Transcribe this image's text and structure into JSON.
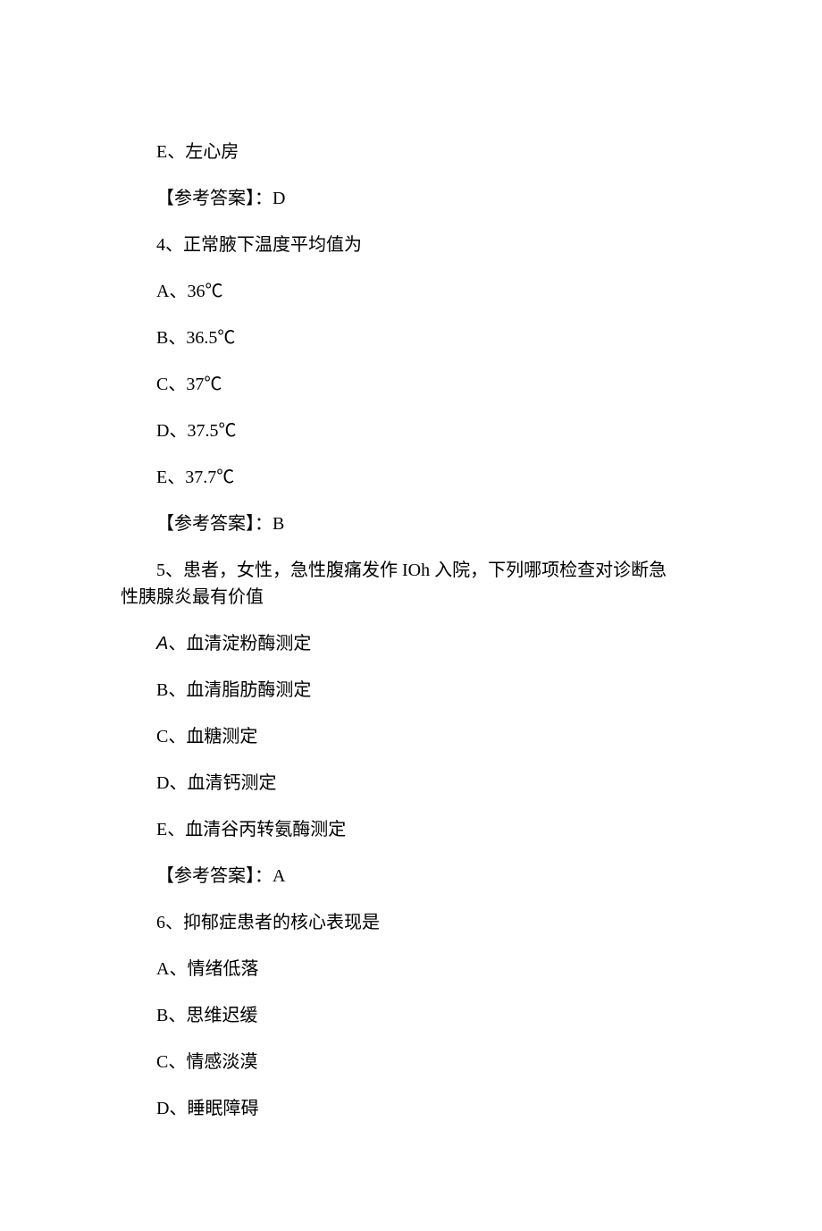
{
  "lines": {
    "q3_optE": "E、左心房",
    "q3_answer": "【参考答案】：D",
    "q4_stem": "4、正常腋下温度平均值为",
    "q4_optA": "A、36℃",
    "q4_optB": "B、36.5℃",
    "q4_optC": "C、37℃",
    "q4_optD": "D、37.5℃",
    "q4_optE": "E、37.7℃",
    "q4_answer": "【参考答案】：B",
    "q5_stem": "5、患者，女性，急性腹痛发作 IOh 入院，下列哪项检查对诊断急性胰腺炎最有价值",
    "q5_optA_prefix": "A",
    "q5_optA_rest": "、血清淀粉酶测定",
    "q5_optB": "B、血清脂肪酶测定",
    "q5_optC": "C、血糖测定",
    "q5_optD": "D、血清钙测定",
    "q5_optE": "E、血清谷丙转氨酶测定",
    "q5_answer": "【参考答案】：A",
    "q6_stem": "6、抑郁症患者的核心表现是",
    "q6_optA": "A、情绪低落",
    "q6_optB": "B、思维迟缓",
    "q6_optC": "C、情感淡漠",
    "q6_optD": "D、睡眠障碍"
  }
}
